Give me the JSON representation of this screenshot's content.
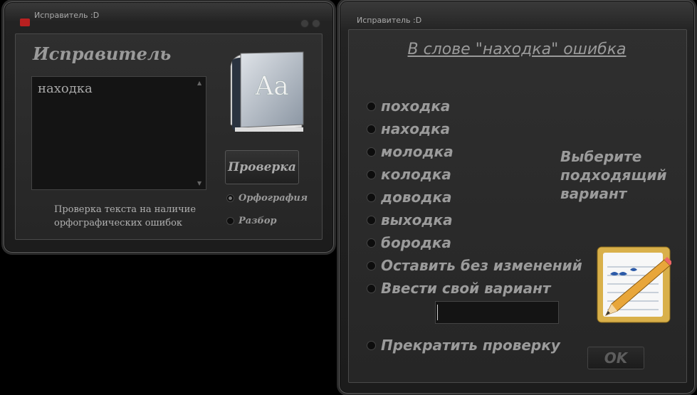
{
  "window1": {
    "title": "Исправитель :D",
    "heading": "Исправитель",
    "input_text": "находка",
    "description": "Проверка текста на наличие орфографических ошибок",
    "check_button": "Проверка",
    "mode_options": [
      {
        "label": "Орфография",
        "selected": true
      },
      {
        "label": "Разбор",
        "selected": false
      }
    ],
    "book_icon_text": "Aa"
  },
  "window2": {
    "title": "Исправитель :D",
    "heading": "В слове \"находка\" ошибка",
    "options": [
      {
        "label": "походка",
        "selected": false
      },
      {
        "label": "находка",
        "selected": false
      },
      {
        "label": "молодка",
        "selected": false
      },
      {
        "label": "колодка",
        "selected": false
      },
      {
        "label": "доводка",
        "selected": false
      },
      {
        "label": "выходка",
        "selected": false
      },
      {
        "label": "бородка",
        "selected": false
      },
      {
        "label": "Оставить без изменений",
        "selected": false
      },
      {
        "label": "Ввести свой вариант",
        "selected": false
      }
    ],
    "own_variant_value": "",
    "stop_option": "Прекратить проверку",
    "hint": "Выберите подходящий вариант",
    "ok_button": "OK"
  }
}
